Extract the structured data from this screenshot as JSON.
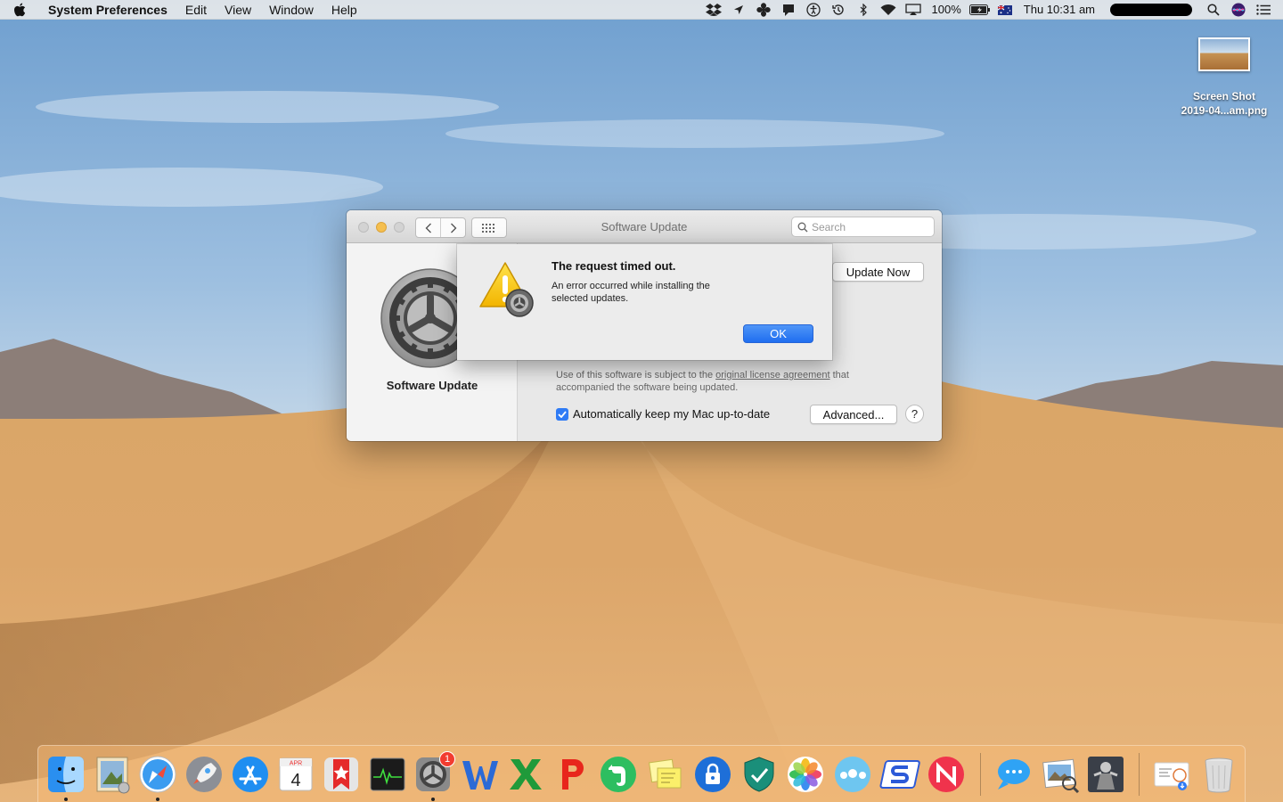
{
  "menubar": {
    "app_name": "System Preferences",
    "menus": [
      "Edit",
      "View",
      "Window",
      "Help"
    ],
    "status_icons": [
      "dropbox-icon",
      "location-icon",
      "fan-icon",
      "notification-icon",
      "accessibility-icon",
      "time-machine-icon",
      "bluetooth-icon",
      "wifi-icon",
      "airplay-icon"
    ],
    "battery": "100%",
    "flag": "australia-flag-icon",
    "clock": "Thu 10:31 am"
  },
  "desktop": {
    "file_line1": "Screen Shot",
    "file_line2": "2019-04...am.png"
  },
  "window": {
    "title": "Software Update",
    "search_placeholder": "Search",
    "pane_label": "Software Update",
    "update_now": "Update Now",
    "license_prefix": "Use of this software is subject to the ",
    "license_link": "original license agreement",
    "license_suffix": " that accompanied the software being updated.",
    "auto_update_label": "Automatically keep my Mac up-to-date",
    "auto_update_checked": true,
    "advanced": "Advanced...",
    "help": "?"
  },
  "alert": {
    "title": "The request timed out.",
    "message": "An error occurred while installing the selected updates.",
    "ok": "OK"
  },
  "dock": {
    "apps": [
      {
        "name": "finder",
        "running": true
      },
      {
        "name": "mail",
        "running": false
      },
      {
        "name": "safari",
        "running": true
      },
      {
        "name": "launchpad",
        "running": false
      },
      {
        "name": "app-store",
        "running": false
      },
      {
        "name": "calendar",
        "running": false
      },
      {
        "name": "bookmark-app",
        "running": false
      },
      {
        "name": "activity-monitor",
        "running": false
      },
      {
        "name": "system-preferences",
        "running": true
      },
      {
        "name": "word",
        "running": false
      },
      {
        "name": "excel",
        "running": false
      },
      {
        "name": "p-app",
        "running": false
      },
      {
        "name": "evernote",
        "running": false
      },
      {
        "name": "stickies",
        "running": false
      },
      {
        "name": "lock-app",
        "running": false
      },
      {
        "name": "shield-app",
        "running": false
      },
      {
        "name": "photos",
        "running": false
      },
      {
        "name": "flickr-dots",
        "running": false
      },
      {
        "name": "s-app",
        "running": false
      },
      {
        "name": "news",
        "running": false
      },
      {
        "name": "messages",
        "running": false
      },
      {
        "name": "preview",
        "running": false
      },
      {
        "name": "game",
        "running": false
      },
      {
        "name": "downloads-folder",
        "running": false
      },
      {
        "name": "trash",
        "running": false
      }
    ],
    "calendar_month": "APR",
    "calendar_day": "4",
    "sysprefs_badge": "1"
  },
  "colors": {
    "accent": "#2f7bf5",
    "minimize": "#f5bf4f",
    "badge": "#f23c30"
  }
}
